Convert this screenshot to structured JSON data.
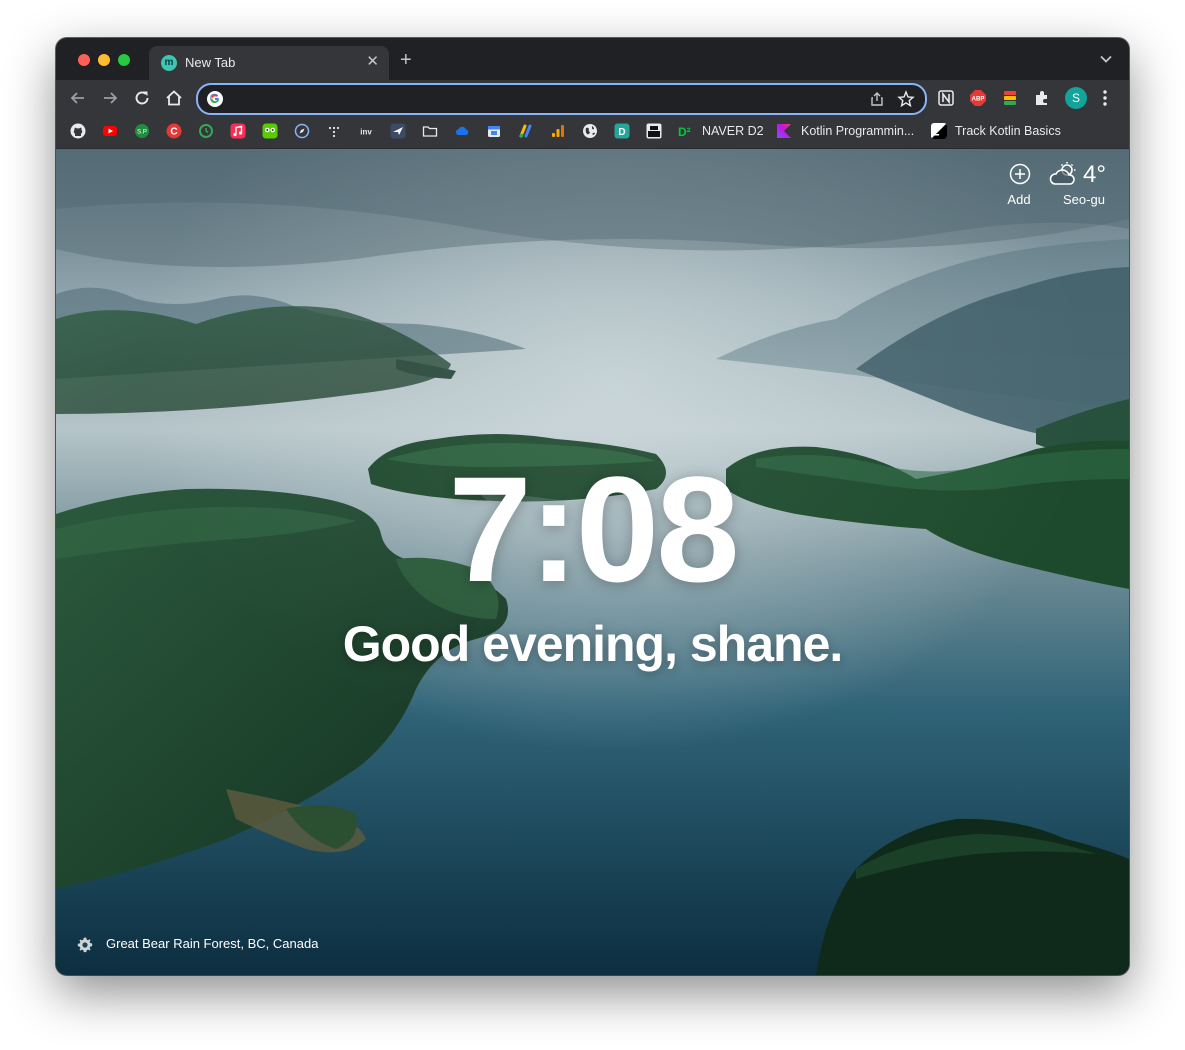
{
  "tab": {
    "title": "New Tab",
    "favicon_letter": "m",
    "favicon_color": "#3dc6b5"
  },
  "omnibox": {
    "value": "",
    "placeholder": ""
  },
  "profile": {
    "initial": "S",
    "color": "#12a39a"
  },
  "bookmarks": {
    "icons": [
      "github-icon",
      "youtube-icon",
      "bookmark-icon",
      "c-icon",
      "clock-icon",
      "music-icon",
      "owl-icon",
      "compass-icon",
      "dots-icon",
      "inv-icon",
      "plane-icon",
      "folder-icon",
      "cloud-icon",
      "calendar-icon",
      "pen-icon",
      "analytics-icon",
      "globe-icon",
      "d-icon",
      "blocks-icon"
    ],
    "naver_label": "NAVER D2",
    "kotlin_label": "Kotlin Programmin...",
    "track_label": "Track Kotlin Basics"
  },
  "newtab": {
    "time": "7:08",
    "greeting": "Good evening, shane.",
    "add_label": "Add",
    "temperature": "4°",
    "weather_location": "Seo-gu",
    "photo_location": "Great Bear Rain Forest, BC, Canada"
  },
  "colors": {
    "chrome_dark": "#202124",
    "toolbar": "#35363a",
    "focus_ring": "#8ab4f8"
  }
}
